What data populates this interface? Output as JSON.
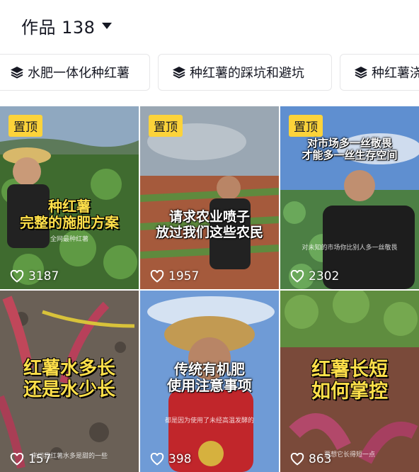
{
  "header": {
    "title": "作品 138"
  },
  "collections": [
    {
      "label": "水肥一体化种红薯",
      "icon": "layers-icon"
    },
    {
      "label": "种红薯的踩坑和避坑",
      "icon": "layers-icon"
    },
    {
      "label": "种红薯浇",
      "icon": "layers-icon"
    }
  ],
  "videos": [
    {
      "pinned": "置顶",
      "caption": [
        "种红薯",
        "完整的施肥方案"
      ],
      "subtitle": "全网最种红薯",
      "likes": "3187"
    },
    {
      "pinned": "置顶",
      "caption": [
        "请求农业喷子",
        "放过我们这些农民"
      ],
      "likes": "1957"
    },
    {
      "pinned": "置顶",
      "caption": [
        "对市场多一丝敬畏",
        "才能多一丝生存空间"
      ],
      "subtitle": "对未知的市场你比别人多一丝敬畏",
      "likes": "2302"
    },
    {
      "caption": [
        "红薯水多长",
        "还是水少长"
      ],
      "subtitle": "来问我红薯水多是甜的一些",
      "likes": "157"
    },
    {
      "caption": [
        "传统有机肥",
        "使用注意事项"
      ],
      "subtitle": "都是因为使用了未经高温发酵的",
      "likes": "398"
    },
    {
      "caption": [
        "红薯长短",
        "如何掌控"
      ],
      "subtitle": "要想它长得短一点",
      "likes": "863"
    }
  ],
  "colors": {
    "pin": "#fcd33a",
    "caption_yellow": "#ffe04a",
    "text": "#161823"
  }
}
